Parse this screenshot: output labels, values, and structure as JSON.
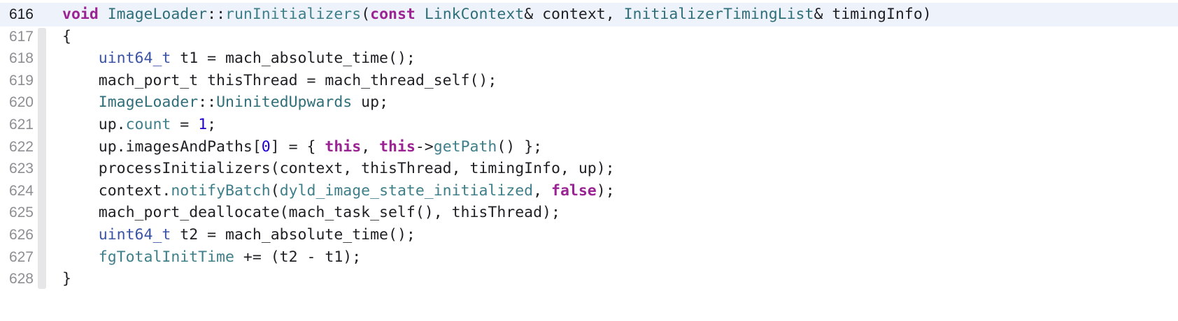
{
  "editor": {
    "current_line": 616,
    "lines": [
      {
        "num": "616",
        "tokens": [
          {
            "t": "void",
            "k": "kw"
          },
          {
            "t": " ",
            "k": "plain"
          },
          {
            "t": "ImageLoader",
            "k": "cls"
          },
          {
            "t": "::",
            "k": "plain"
          },
          {
            "t": "runInitializers",
            "k": "fn"
          },
          {
            "t": "(",
            "k": "plain"
          },
          {
            "t": "const",
            "k": "kw"
          },
          {
            "t": " ",
            "k": "plain"
          },
          {
            "t": "LinkContext",
            "k": "cls"
          },
          {
            "t": "& context, ",
            "k": "plain"
          },
          {
            "t": "InitializerTimingList",
            "k": "cls"
          },
          {
            "t": "& timingInfo)",
            "k": "plain"
          }
        ]
      },
      {
        "num": "617",
        "tokens": [
          {
            "t": "{",
            "k": "plain"
          }
        ]
      },
      {
        "num": "618",
        "tokens": [
          {
            "t": "    ",
            "k": "plain"
          },
          {
            "t": "uint64_t",
            "k": "type"
          },
          {
            "t": " t1 = mach_absolute_time();",
            "k": "plain"
          }
        ]
      },
      {
        "num": "619",
        "tokens": [
          {
            "t": "    mach_port_t thisThread = mach_thread_self();",
            "k": "plain"
          }
        ]
      },
      {
        "num": "620",
        "tokens": [
          {
            "t": "    ",
            "k": "plain"
          },
          {
            "t": "ImageLoader",
            "k": "cls"
          },
          {
            "t": "::",
            "k": "plain"
          },
          {
            "t": "UninitedUpwards",
            "k": "cls"
          },
          {
            "t": " up;",
            "k": "plain"
          }
        ]
      },
      {
        "num": "621",
        "tokens": [
          {
            "t": "    up.",
            "k": "plain"
          },
          {
            "t": "count",
            "k": "fn"
          },
          {
            "t": " = ",
            "k": "plain"
          },
          {
            "t": "1",
            "k": "num"
          },
          {
            "t": ";",
            "k": "plain"
          }
        ]
      },
      {
        "num": "622",
        "tokens": [
          {
            "t": "    up.imagesAndPaths[",
            "k": "plain"
          },
          {
            "t": "0",
            "k": "num"
          },
          {
            "t": "] = { ",
            "k": "plain"
          },
          {
            "t": "this",
            "k": "kw"
          },
          {
            "t": ", ",
            "k": "plain"
          },
          {
            "t": "this",
            "k": "kw"
          },
          {
            "t": "->",
            "k": "plain"
          },
          {
            "t": "getPath",
            "k": "fn"
          },
          {
            "t": "() };",
            "k": "plain"
          }
        ]
      },
      {
        "num": "623",
        "tokens": [
          {
            "t": "    processInitializers(context, thisThread, timingInfo, up);",
            "k": "plain"
          }
        ]
      },
      {
        "num": "624",
        "tokens": [
          {
            "t": "    context.",
            "k": "plain"
          },
          {
            "t": "notifyBatch",
            "k": "fn"
          },
          {
            "t": "(",
            "k": "plain"
          },
          {
            "t": "dyld_image_state_initialized",
            "k": "fn"
          },
          {
            "t": ", ",
            "k": "plain"
          },
          {
            "t": "false",
            "k": "kw"
          },
          {
            "t": ");",
            "k": "plain"
          }
        ]
      },
      {
        "num": "625",
        "tokens": [
          {
            "t": "    mach_port_deallocate(mach_task_self(), thisThread);",
            "k": "plain"
          }
        ]
      },
      {
        "num": "626",
        "tokens": [
          {
            "t": "    ",
            "k": "plain"
          },
          {
            "t": "uint64_t",
            "k": "type"
          },
          {
            "t": " t2 = mach_absolute_time();",
            "k": "plain"
          }
        ]
      },
      {
        "num": "627",
        "tokens": [
          {
            "t": "    ",
            "k": "plain"
          },
          {
            "t": "fgTotalInitTime",
            "k": "fn"
          },
          {
            "t": " += (t2 - t1);",
            "k": "plain"
          }
        ]
      },
      {
        "num": "628",
        "tokens": [
          {
            "t": "}",
            "k": "plain"
          }
        ]
      }
    ]
  },
  "colors": {
    "keyword": "#9b2393",
    "type": "#3a53a4",
    "class": "#2f6f7a",
    "function": "#3e7f8a",
    "number": "#1c00cf",
    "plain": "#1f1f24",
    "current_line_bg": "#eef3fb"
  }
}
